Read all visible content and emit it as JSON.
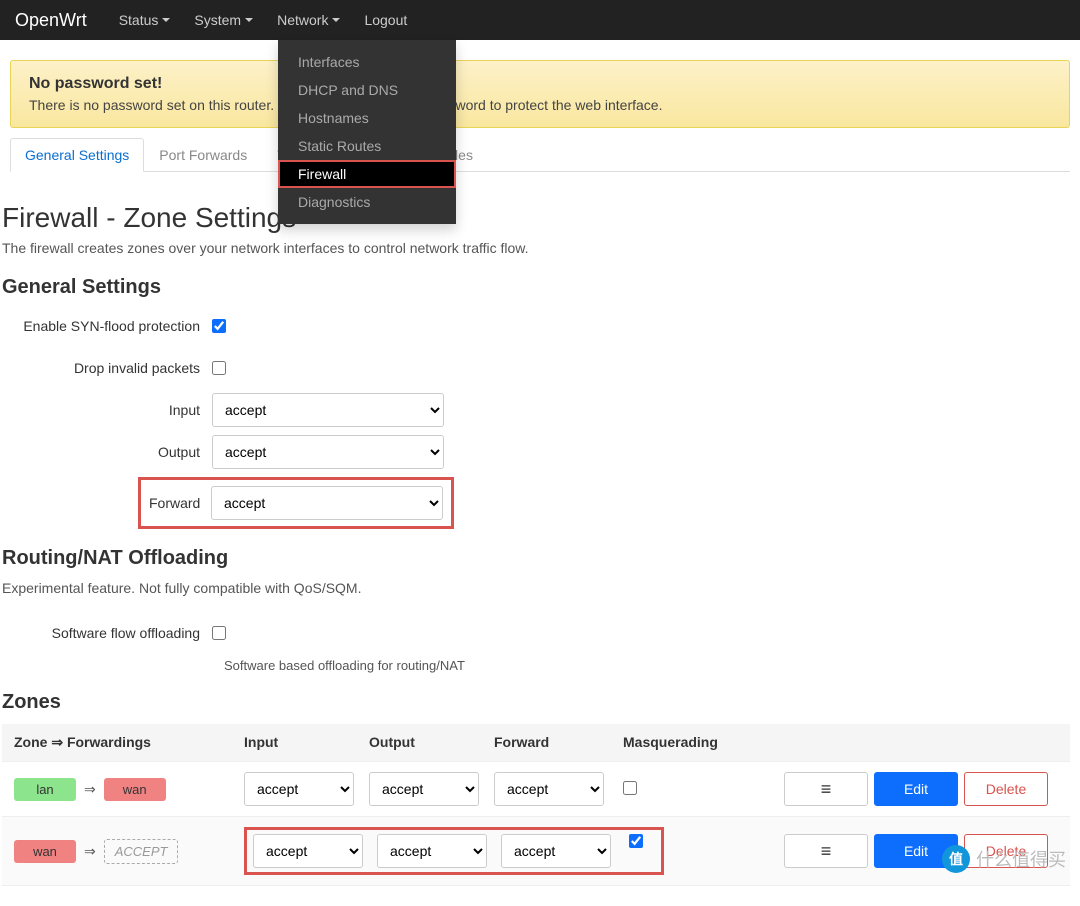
{
  "navbar": {
    "brand": "OpenWrt",
    "items": [
      "Status",
      "System",
      "Network",
      "Logout"
    ]
  },
  "dropdown": {
    "items": [
      "Interfaces",
      "DHCP and DNS",
      "Hostnames",
      "Static Routes",
      "Firewall",
      "Diagnostics"
    ],
    "activeIndex": 4
  },
  "alert": {
    "title": "No password set!",
    "text": "There is no password set on this router. Please configure a root password to protect the web interface."
  },
  "tabs": {
    "items": [
      "General Settings",
      "Port Forwards",
      "Traffic Rules",
      "Custom Rules"
    ],
    "activeIndex": 0
  },
  "page": {
    "title": "Firewall - Zone Settings",
    "desc": "The firewall creates zones over your network interfaces to control network traffic flow."
  },
  "general": {
    "heading": "General Settings",
    "syn_label": "Enable SYN-flood protection",
    "syn_checked": true,
    "drop_label": "Drop invalid packets",
    "drop_checked": false,
    "input_label": "Input",
    "input_value": "accept",
    "output_label": "Output",
    "output_value": "accept",
    "forward_label": "Forward",
    "forward_value": "accept"
  },
  "routing": {
    "heading": "Routing/NAT Offloading",
    "desc": "Experimental feature. Not fully compatible with QoS/SQM.",
    "sfo_label": "Software flow offloading",
    "sfo_checked": false,
    "sfo_help": "Software based offloading for routing/NAT"
  },
  "zones": {
    "heading": "Zones",
    "cols": {
      "zf": "Zone ⇒ Forwardings",
      "input": "Input",
      "output": "Output",
      "forward": "Forward",
      "masq": "Masquerading"
    },
    "rows": [
      {
        "from": "lan",
        "fromClass": "zone-lan",
        "to": "wan",
        "toClass": "zone-wan",
        "toDashed": false,
        "input": "accept",
        "output": "accept",
        "forward": "accept",
        "masq": false,
        "highlight": false
      },
      {
        "from": "wan",
        "fromClass": "zone-wan",
        "to": "ACCEPT",
        "toClass": "zone-accept",
        "toDashed": true,
        "input": "accept",
        "output": "accept",
        "forward": "accept",
        "masq": true,
        "highlight": true
      }
    ],
    "btn_reorder": "≡",
    "btn_edit": "Edit",
    "btn_delete": "Delete"
  },
  "watermark": {
    "icon": "值",
    "text": "什么值得买"
  }
}
